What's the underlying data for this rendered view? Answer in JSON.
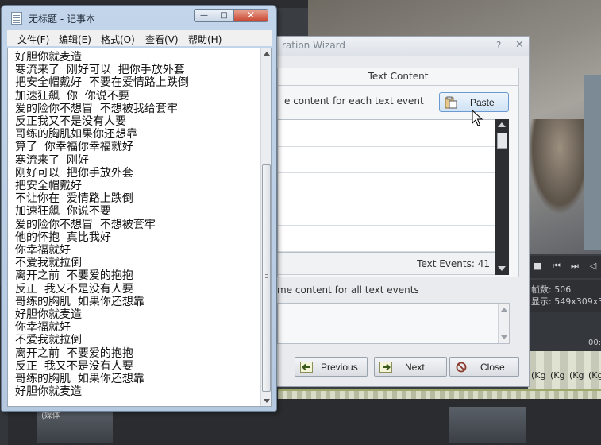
{
  "notepad": {
    "title": "无标题 - 记事本",
    "controls": {
      "minimize": "—",
      "maximize": "□",
      "close": "✕"
    },
    "menu": [
      "文件(F)",
      "编辑(E)",
      "格式(O)",
      "查看(V)",
      "帮助(H)"
    ],
    "lines": [
      "好胆你就麦造",
      "寒流来了  刚好可以  把你手放外套",
      "把安全帽戴好  不要在爱情路上跌倒",
      "加速狂飙  你  你说不要",
      "爱的险你不想冒  不想被我给套牢",
      "反正我又不是没有人要",
      "哥练的胸肌如果你还想靠",
      "算了  你幸福你幸福就好",
      "寒流来了  刚好",
      "刚好可以  把你手放外套",
      "把安全帽戴好",
      "不让你在  爱情路上跌倒",
      "加速狂飙  你说不要",
      "爱的险你不想冒  不想被套牢",
      "他的怀抱  真比我好",
      "你幸福就好",
      "不爱我就拉倒",
      "离开之前  不要爱的抱抱",
      "反正  我又不是没有人要",
      "哥练的胸肌  如果你还想靠",
      "好胆你就麦造",
      "你幸福就好",
      "不爱我就拉倒",
      "离开之前  不要爱的抱抱",
      "反正  我又不是没有人要",
      "哥练的胸肌  如果你还想靠",
      "好胆你就麦造"
    ]
  },
  "wizard": {
    "title": "ration Wizard",
    "help": "?",
    "close": "✕",
    "panel_header": "Text Content",
    "instruction": "e content for each text event",
    "paste_label": "Paste",
    "events_count": "Text Events: 41",
    "same_label": "me content for all text events",
    "buttons": {
      "previous": "Previous",
      "next": "Next",
      "close": "Close"
    }
  },
  "editor": {
    "frame_label": "帧数:",
    "frame_value": "506",
    "display_label": "显示:",
    "display_value": "549x309x3",
    "ruler_mark": "00:",
    "clip_label": "(Kg",
    "thumb_label": "(媒体"
  },
  "colors": {
    "accent": "#6b9ad0",
    "close_red": "#c9452e",
    "timeline_bg": "#2a2c30"
  },
  "icons": {
    "paste": "clipboard-icon",
    "previous": "arrow-left-icon",
    "next": "arrow-right-icon",
    "close": "no-entry-icon"
  }
}
